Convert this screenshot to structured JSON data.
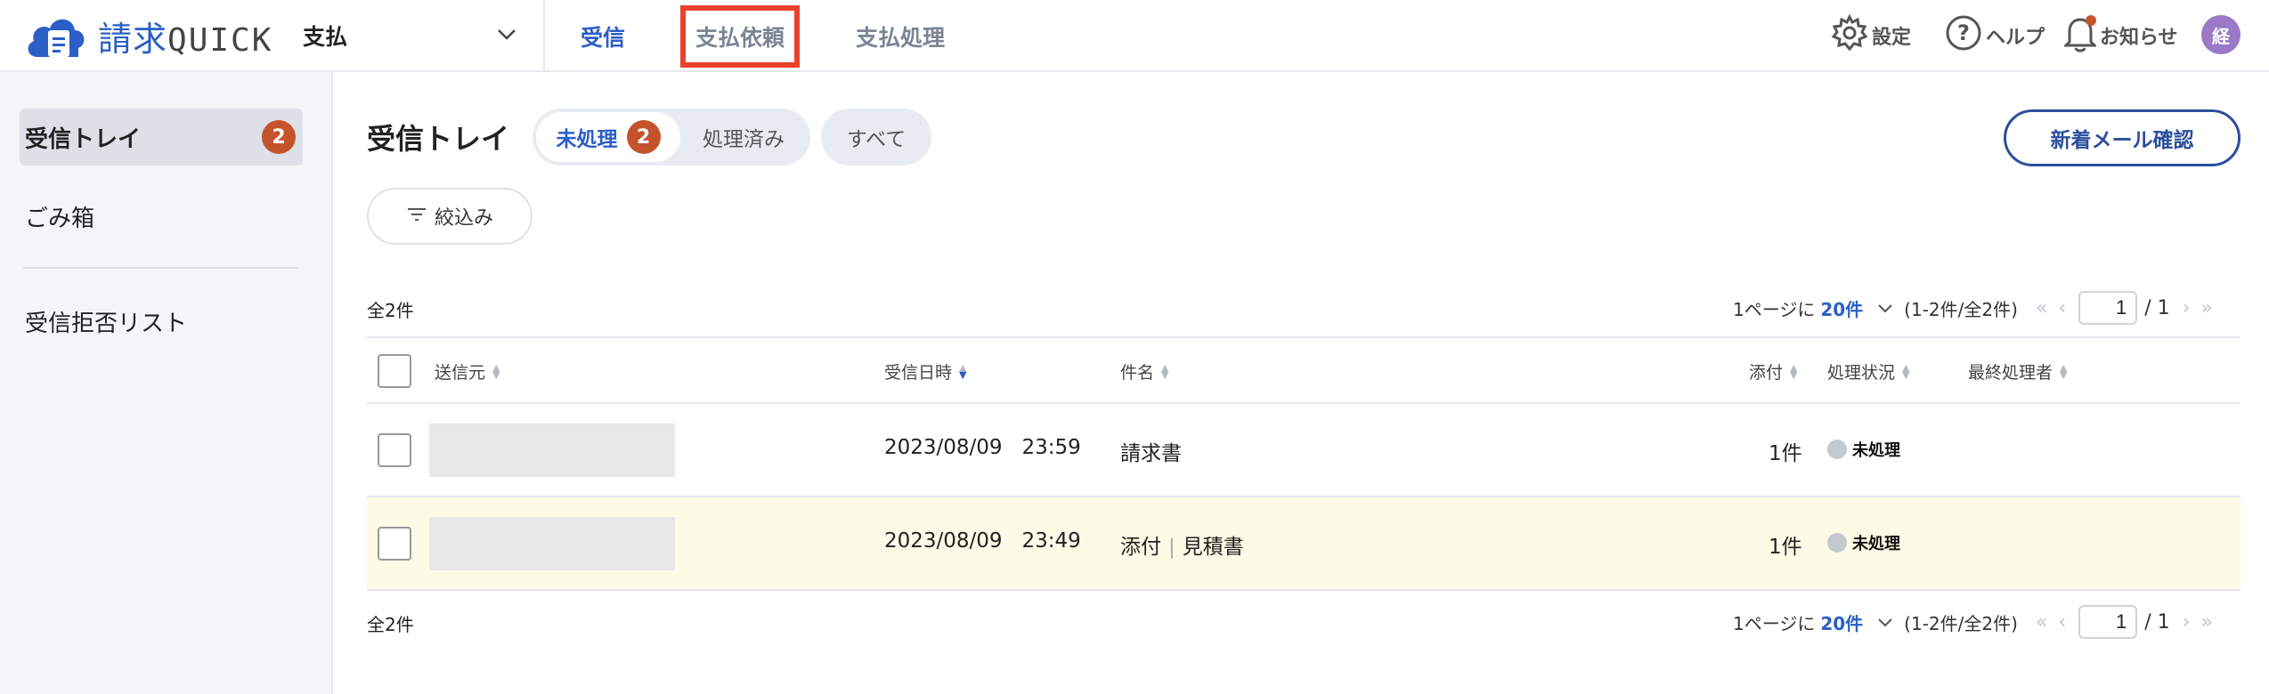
{
  "header": {
    "logo_kanji": "請求",
    "logo_latin": "QUICK",
    "module": "支払",
    "tabs": [
      {
        "label": "受信"
      },
      {
        "label": "支払依頼"
      },
      {
        "label": "支払処理"
      }
    ],
    "settings": "設定",
    "help": "ヘルプ",
    "notifications": "お知らせ",
    "avatar": "経",
    "colors": {
      "brand": "#2b5fc7",
      "highlight_box": "#e8412c",
      "badge": "#c4532c"
    }
  },
  "sidebar": {
    "items": [
      {
        "label": "受信トレイ",
        "badge": "2"
      },
      {
        "label": "ごみ箱"
      },
      {
        "label": "受信拒否リスト"
      }
    ]
  },
  "main": {
    "title": "受信トレイ",
    "filters": [
      {
        "label": "未処理",
        "badge": "2"
      },
      {
        "label": "処理済み"
      },
      {
        "label": "すべて"
      }
    ],
    "new_mail_button": "新着メール確認",
    "filter_button": "絞込み",
    "total": "全2件",
    "pager": {
      "per_page_prefix": "1ページに",
      "per_page": "20件",
      "range": "(1-2件/全2件)",
      "page": "1",
      "total_pages": "/ 1"
    },
    "columns": [
      "送信元",
      "受信日時",
      "件名",
      "添付",
      "処理状況",
      "最終処理者"
    ],
    "rows": [
      {
        "date": "2023/08/09",
        "time": "23:59",
        "subject_tag": "",
        "subject": "請求書",
        "attachments": "1件",
        "status": "未処理"
      },
      {
        "date": "2023/08/09",
        "time": "23:49",
        "subject_tag": "添付",
        "subject": "見積書",
        "attachments": "1件",
        "status": "未処理"
      }
    ]
  }
}
